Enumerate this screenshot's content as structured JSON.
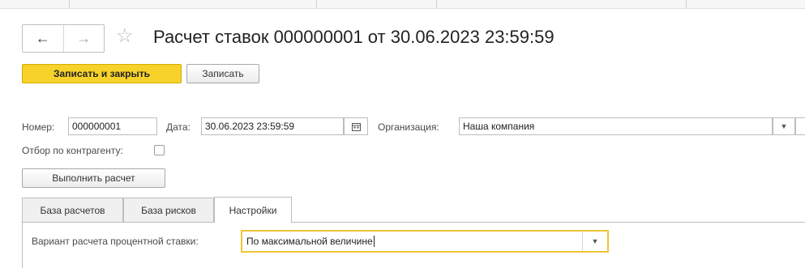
{
  "window": {
    "title": "Расчет ставок 000000001 от 30.06.2023 23:59:59",
    "back_icon": "arrow-left-icon",
    "forward_icon": "arrow-right-icon",
    "favorite_icon": "star-icon"
  },
  "toolbar": {
    "save_close_label": "Записать и закрыть",
    "save_label": "Записать"
  },
  "header": {
    "number_label": "Номер:",
    "number_value": "000000001",
    "date_label": "Дата:",
    "date_value": "30.06.2023 23:59:59",
    "org_label": "Организация:",
    "org_value": "Наша компания",
    "filter_label": "Отбор по контрагенту:",
    "filter_checked": false,
    "run_label": "Выполнить расчет"
  },
  "tabs": [
    {
      "label": "База расчетов",
      "active": false
    },
    {
      "label": "База рисков",
      "active": false
    },
    {
      "label": "Настройки",
      "active": true
    }
  ],
  "settings": {
    "rate_variant_label": "Вариант расчета процентной ставки:",
    "rate_variant_value": "По максимальной величине"
  },
  "colors": {
    "primary_button": "#f7d22a",
    "focus_border": "#f0c537"
  }
}
